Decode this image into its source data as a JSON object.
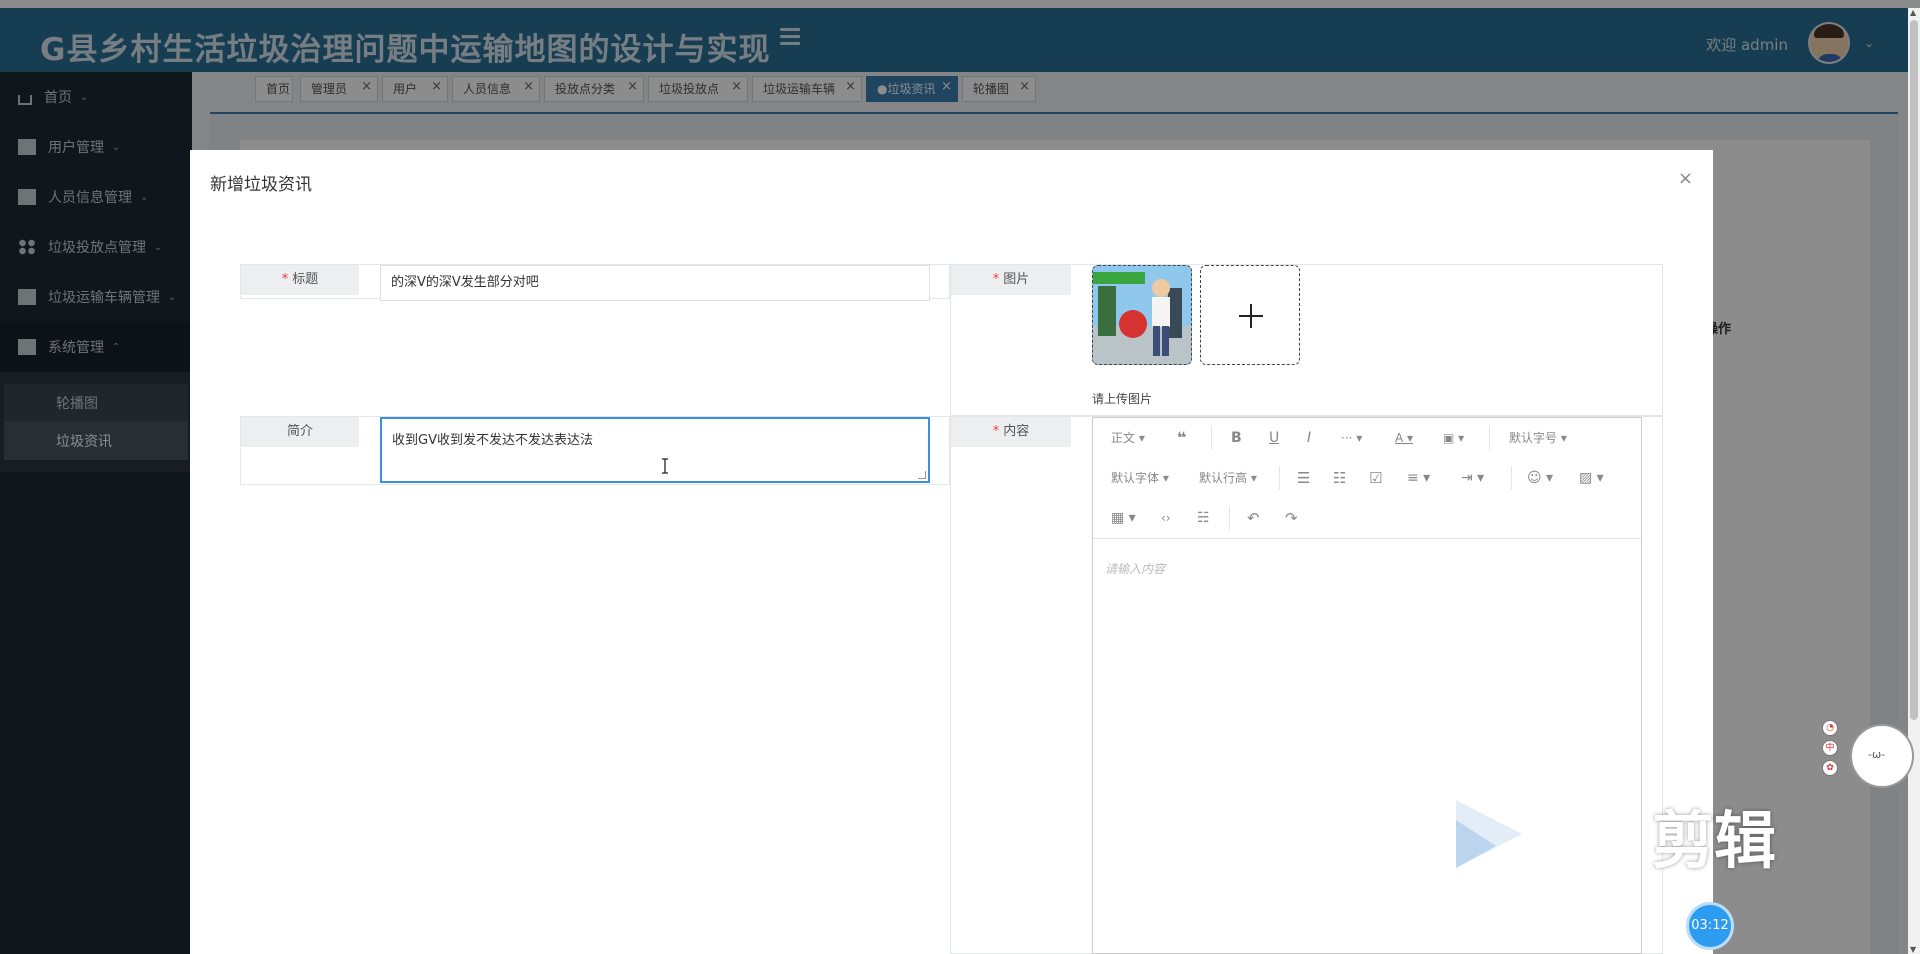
{
  "header": {
    "app_title": "G县乡村生活垃圾治理问题中运输地图的设计与实现",
    "welcome": "欢迎 admin"
  },
  "sidebar": {
    "items": [
      {
        "label": "首页",
        "icon": "home-icon"
      },
      {
        "label": "用户管理",
        "icon": "building-icon"
      },
      {
        "label": "人员信息管理",
        "icon": "layers-icon"
      },
      {
        "label": "垃圾投放点管理",
        "icon": "dots-grid-icon"
      },
      {
        "label": "垃圾运输车辆管理",
        "icon": "grid-building-icon"
      },
      {
        "label": "系统管理",
        "icon": "server-icon"
      }
    ],
    "sub_items": [
      {
        "label": "轮播图"
      },
      {
        "label": "垃圾资讯"
      }
    ]
  },
  "tabs": [
    {
      "label": "首页"
    },
    {
      "label": "管理员"
    },
    {
      "label": "用户"
    },
    {
      "label": "人员信息"
    },
    {
      "label": "投放点分类"
    },
    {
      "label": "垃圾投放点"
    },
    {
      "label": "垃圾运输车辆"
    },
    {
      "label": "●垃圾资讯"
    },
    {
      "label": "轮播图"
    }
  ],
  "page": {
    "operation_header": "操作"
  },
  "dialog": {
    "title": "新增垃圾资讯",
    "close": "×",
    "fields": {
      "title_label": "标题",
      "title_value": "的深V的深V发生部分对吧",
      "intro_label": "简介",
      "intro_value": "收到GV收到发不发达不发达表达法",
      "image_label": "图片",
      "upload_hint": "请上传图片",
      "content_label": "内容",
      "required_mark": "*",
      "upload_plus": "+"
    },
    "editor": {
      "placeholder": "请输入内容",
      "toolbar": {
        "paragraph": "正文",
        "font_size": "默认字号",
        "font_family": "默认字体",
        "line_height": "默认行高"
      }
    }
  },
  "overlay_widgets": {
    "watermark_text": "剪辑",
    "timer": "03:12",
    "mascot_face": "-ω-"
  },
  "colors": {
    "header_bg": "#2b6f95",
    "sidebar_bg": "#1e2a33",
    "active_tab": "#3b7eb0",
    "required": "#e64242",
    "focus_border": "#3b8ee6"
  }
}
